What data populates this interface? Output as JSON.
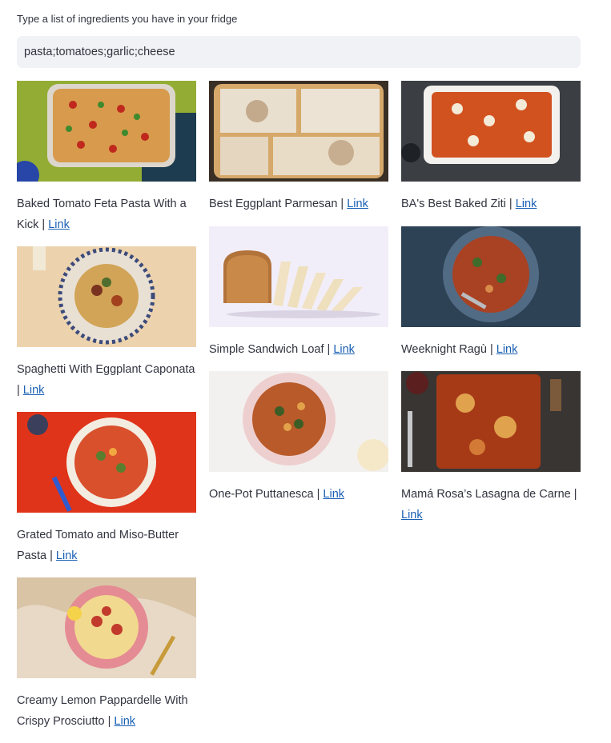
{
  "input": {
    "label": "Type a list of ingredients you have in your fridge",
    "value": "pasta;tomatoes;garlic;cheese"
  },
  "recipes": [
    {
      "title": "Baked Tomato Feta Pasta With a Kick",
      "separator": " | ",
      "link_label": "Link",
      "image": "baked-tomato-feta-pasta-photo",
      "bg": "#8fa833"
    },
    {
      "title": "Spaghetti With Eggplant Caponata",
      "separator": " | ",
      "link_label": "Link",
      "image": "spaghetti-eggplant-caponata-photo",
      "bg": "#ebd2ae"
    },
    {
      "title": "Grated Tomato and Miso-Butter Pasta",
      "separator": " | ",
      "link_label": "Link",
      "image": "grated-tomato-miso-pasta-photo",
      "bg": "#e03017"
    },
    {
      "title": "Creamy Lemon Pappardelle With Crispy Prosciutto",
      "separator": " | ",
      "link_label": "Link",
      "image": "lemon-pappardelle-photo",
      "bg": "#e6d8c6"
    },
    {
      "title": "Best Eggplant Parmesan",
      "separator": " | ",
      "link_label": "Link",
      "image": "eggplant-parmesan-photo",
      "bg": "#3a3128"
    },
    {
      "title": "Simple Sandwich Loaf",
      "separator": " | ",
      "link_label": "Link",
      "image": "sandwich-loaf-photo",
      "bg": "#f1edf8"
    },
    {
      "title": "One-Pot Puttanesca",
      "separator": " | ",
      "link_label": "Link",
      "image": "puttanesca-photo",
      "bg": "#f3f1ef"
    },
    {
      "title": "BA's Best Baked Ziti",
      "separator": " | ",
      "link_label": "Link",
      "image": "baked-ziti-photo",
      "bg": "#3a3d42"
    },
    {
      "title": "Weeknight Ragù",
      "separator": " | ",
      "link_label": "Link",
      "image": "weeknight-ragu-photo",
      "bg": "#2f4257"
    },
    {
      "title": "Mamá Rosa’s Lasagna de Carne",
      "separator": " | ",
      "link_label": "Link",
      "image": "lasagna-de-carne-photo",
      "bg": "#3a3734"
    }
  ]
}
